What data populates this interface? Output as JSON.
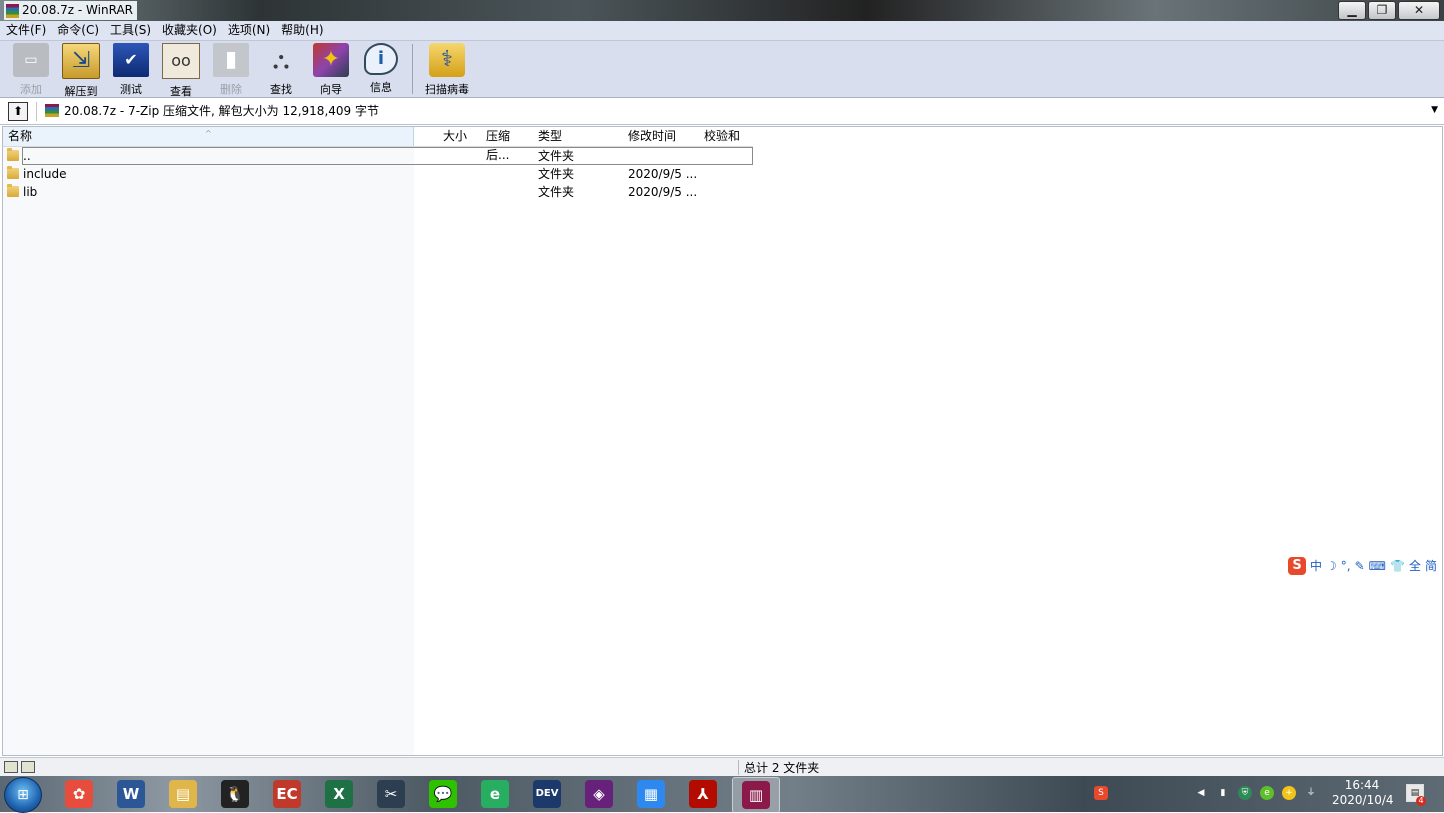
{
  "window": {
    "title": "20.08.7z - WinRAR",
    "controls": {
      "minimize": "▁",
      "maximize": "❐",
      "close": "✕"
    }
  },
  "menu": [
    "文件(F)",
    "命令(C)",
    "工具(S)",
    "收藏夹(O)",
    "选项(N)",
    "帮助(H)"
  ],
  "toolbar": {
    "buttons": [
      {
        "label": "添加",
        "icon": "add-icon",
        "enabled": false
      },
      {
        "label": "解压到",
        "icon": "extract-icon",
        "enabled": true
      },
      {
        "label": "测试",
        "icon": "test-icon",
        "enabled": true
      },
      {
        "label": "查看",
        "icon": "view-icon",
        "enabled": true
      },
      {
        "label": "删除",
        "icon": "delete-icon",
        "enabled": false
      },
      {
        "label": "查找",
        "icon": "find-icon",
        "enabled": true
      },
      {
        "label": "向导",
        "icon": "wizard-icon",
        "enabled": true
      },
      {
        "label": "信息",
        "icon": "info-icon",
        "enabled": true
      }
    ],
    "scan": {
      "label": "扫描病毒",
      "icon": "virus-scan-icon"
    }
  },
  "address": {
    "up_glyph": "⬆",
    "text": "20.08.7z - 7-Zip 压缩文件, 解包大小为 12,918,409 字节",
    "dropdown_glyph": "▼"
  },
  "columns": {
    "name": "名称",
    "size": "大小",
    "packed": "压缩后...",
    "type": "类型",
    "modified": "修改时间",
    "crc": "校验和",
    "sort_glyph": "^"
  },
  "rows": [
    {
      "name": "..",
      "type": "文件夹",
      "modified": ""
    },
    {
      "name": "include",
      "type": "文件夹",
      "modified": "2020/9/5 ..."
    },
    {
      "name": "lib",
      "type": "文件夹",
      "modified": "2020/9/5 ..."
    }
  ],
  "ime": {
    "logo": "S",
    "items": [
      "中",
      "☽",
      "°,",
      "✎",
      "⌨",
      "👕",
      "全",
      "简"
    ]
  },
  "status": {
    "text": "总计 2 文件夹"
  },
  "taskbar": {
    "start_glyph": "⊞",
    "apps": [
      {
        "name": "picasa",
        "glyph": "✿",
        "color": "#e74c3c",
        "active": false
      },
      {
        "name": "word",
        "glyph": "W",
        "color": "#2b5797",
        "active": false
      },
      {
        "name": "explorer",
        "glyph": "▤",
        "color": "#e0b64a",
        "active": false
      },
      {
        "name": "qq",
        "glyph": "🐧",
        "color": "#222222",
        "active": false
      },
      {
        "name": "calendar",
        "glyph": "EC",
        "color": "#c0392b",
        "active": false
      },
      {
        "name": "excel",
        "glyph": "X",
        "color": "#1e7145",
        "active": false
      },
      {
        "name": "clipper",
        "glyph": "✂",
        "color": "#2c3e50",
        "active": false
      },
      {
        "name": "wechat",
        "glyph": "💬",
        "color": "#2dc100",
        "active": false
      },
      {
        "name": "browser",
        "glyph": "e",
        "color": "#27ae60",
        "active": false
      },
      {
        "name": "dev-cpp",
        "glyph": "DEV",
        "color": "#1b3a6b",
        "active": false
      },
      {
        "name": "visual-studio",
        "glyph": "◈",
        "color": "#68217a",
        "active": false
      },
      {
        "name": "tiles",
        "glyph": "▦",
        "color": "#2d89ef",
        "active": false
      },
      {
        "name": "acrobat",
        "glyph": "⅄",
        "color": "#b30b00",
        "active": false
      },
      {
        "name": "winrar",
        "glyph": "▥",
        "color": "#8b1a4a",
        "active": true
      }
    ],
    "tray": {
      "time": "16:44",
      "date": "2020/10/4",
      "notifications": "4"
    }
  }
}
